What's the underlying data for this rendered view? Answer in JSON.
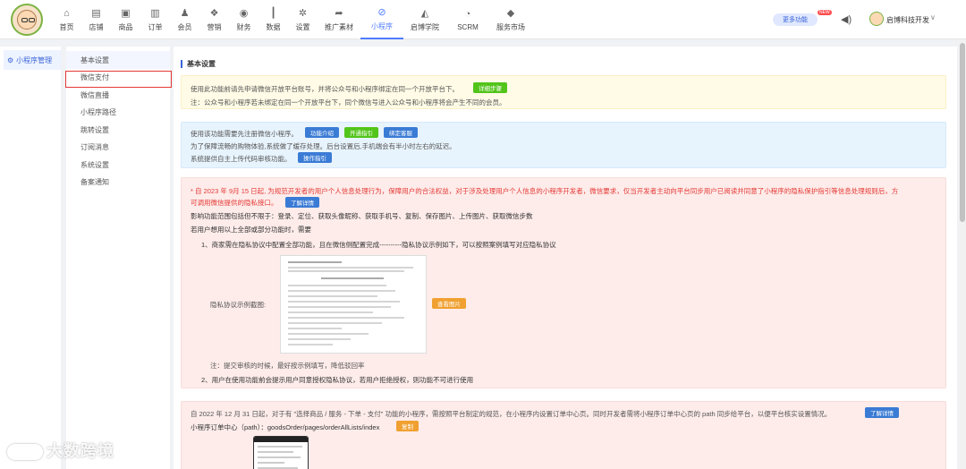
{
  "topnav": {
    "items": [
      {
        "label": "首页",
        "icon": "home-icon",
        "glyph": "⌂"
      },
      {
        "label": "店铺",
        "icon": "store-icon",
        "glyph": "▤"
      },
      {
        "label": "商品",
        "icon": "goods-icon",
        "glyph": "▣"
      },
      {
        "label": "订单",
        "icon": "order-icon",
        "glyph": "▥"
      },
      {
        "label": "会员",
        "icon": "member-icon",
        "glyph": "♟"
      },
      {
        "label": "营销",
        "icon": "marketing-icon",
        "glyph": "❖"
      },
      {
        "label": "财务",
        "icon": "finance-icon",
        "glyph": "◉"
      },
      {
        "label": "数据",
        "icon": "data-icon",
        "glyph": "┃"
      },
      {
        "label": "设置",
        "icon": "settings-icon",
        "glyph": "✲"
      },
      {
        "label": "推广素材",
        "icon": "share-icon",
        "glyph": "➦"
      },
      {
        "label": "小程序",
        "icon": "miniprogram-icon",
        "glyph": "⊘",
        "active": true
      },
      {
        "label": "启博学院",
        "icon": "academy-icon",
        "glyph": "◭"
      },
      {
        "label": "SCRM",
        "icon": "scrm-icon",
        "glyph": "◔"
      },
      {
        "label": "服务市场",
        "icon": "market-icon",
        "glyph": "◆"
      }
    ],
    "more_label": "更多功能",
    "new_badge": "NEW",
    "user_name": "启博科技开发",
    "active_color": "#4f7cff"
  },
  "sidebar_primary": {
    "label": "小程序管理",
    "icon": "gear-icon"
  },
  "sidebar_secondary": {
    "items": [
      "基本设置",
      "微信支付",
      "微信直播",
      "小程序路径",
      "跳转设置",
      "订阅消息",
      "系统设置",
      "备案通知"
    ]
  },
  "main": {
    "section_title": "基本设置",
    "notice1": {
      "line1": "使用此功能前请先申请微信开放平台账号，并将公众号和小程序绑定在同一个开放平台下。",
      "button": "详细步骤",
      "line2": "注：公众号和小程序若未绑定在同一个开放平台下，同个微信号进入公众号和小程序将会产生不同的会员。"
    },
    "notice2": {
      "line1": "使用该功能需要先注册微信小程序。",
      "btn_intro": "功能介绍",
      "btn_guide": "开通指引",
      "btn_bind": "绑定客服",
      "line2": "为了保障流畅的购物体验,系统做了缓存处理。后台设置后,手机端会有半小时左右的延迟。",
      "line3": "系统提供自主上传代码审核功能。",
      "btn_op": "操作指引"
    },
    "notice3": {
      "line1": "* 自 2023 年 9月 15 日起, 为规范开发者的用户个人信息处理行为，保障用户的合法权益，对于涉及处理用户个人信息的小程序开发者，微信要求，仅当开发者主动向平台同步用户已阅读并同意了小程序的隐私保护指引等信息处理规则后，方",
      "line2": "可调用微信提供的隐私接口。",
      "btn_detail": "了解详情",
      "line3": "影响功能范围包括但不限于：登录、定位、获取头像昵称、获取手机号、复制、保存图片、上传图片、获取微信步数",
      "line4": "若用户想用以上全部或部分功能时，需要",
      "step1": "1、商家需在隐私协议中配置全部功能，且在微信侧配置完成----------隐私协议示例如下，可以按照案例填写对应隐私协议",
      "example_label": "隐私协议示例截图:",
      "btn_view": "查看图片",
      "note": "注：提交审核的时候，最好按示例填写，降低驳回率",
      "step2": "2、用户在使用功能前会提示用户同意授权隐私协议，若用户拒绝授权，则功能不可进行使用"
    },
    "notice4": {
      "line1": "自 2022 年 12 月 31 日起，对于有 \"选择商品 / 服务 - 下单 - 支付\" 功能的小程序，需按照平台制定的规范，在小程序内设置订单中心页。同时开发者需将小程序订单中心页的 path 同步给平台，以便平台核实设置情况。",
      "btn_detail": "了解详情",
      "path_label": "小程序订单中心（path）：goodsOrder/pages/orderAllLists/index",
      "btn_copy": "复制"
    }
  },
  "watermark": "大数跨境"
}
